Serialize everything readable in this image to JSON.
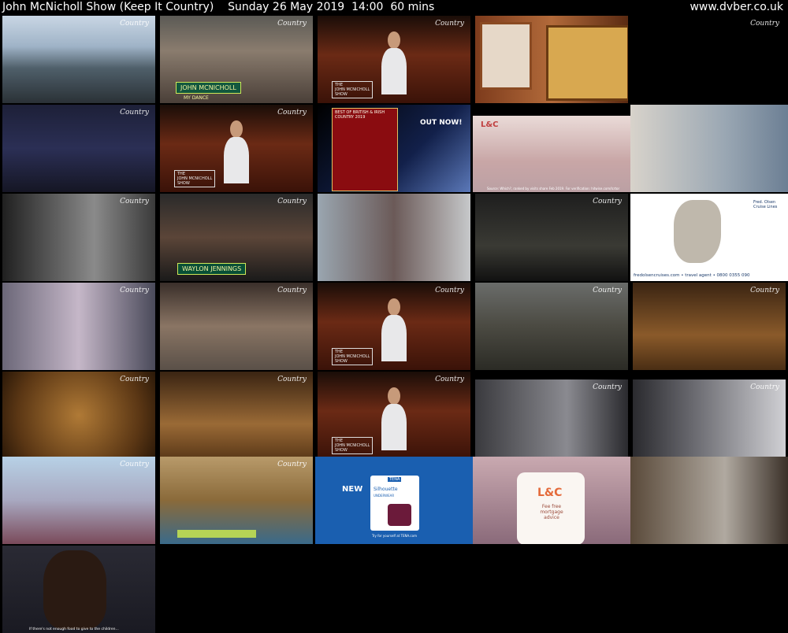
{
  "header": {
    "title": "John McNicholl Show (Keep It Country)    Sunday 26 May 2019  14:00  60 mins",
    "site": "www.dvber.co.uk"
  },
  "overlays": {
    "channel_logo": "Country",
    "caption_john": "JOHN MCNICHOLL",
    "caption_john_sub": "MY DANCE",
    "show_tag": "THE\nJOHN MCNICHOLL\nSHOW",
    "out_now": "OUT NOW!",
    "album_banner": "BEST OF BRITISH & IRISH COUNTRY 2019",
    "lc_disclaimer": "Source: Which?, ranked by visits share Feb 2019. For verification: hitwise.com/lcrtor",
    "caption_waylon": "WAYLON JENNINGS",
    "fred_url": "fredolsencruises.com • travel agent • 0800 0355 090",
    "fred_brand": "Fred. Olsen Cruise Lines",
    "tena_new": "NEW",
    "tena_brand": "TENA",
    "tena_product": "Silhouette",
    "tena_sub": "UNDERWEAR",
    "tena_footer": "Try for yourself at TENA.com",
    "lc_brand": "L&C",
    "lc_tagline": "Fee free mortgage advice",
    "charity_subtitle": "If there's not enough food to give to the children..."
  },
  "thumbnails": [
    {
      "name": "frame-bridge-walk",
      "bg": "linear-gradient(180deg,#c9d6e4 0%,#9fb3c7 35%,#4f5f6a 60%,#2a3136 100%)"
    },
    {
      "name": "frame-street-dancers",
      "bg": "linear-gradient(180deg,#5b5a55 0%,#8a7c6e 40%,#4a3f38 100%)"
    },
    {
      "name": "frame-studio-presenter",
      "bg": "linear-gradient(180deg,#1a0d08 0%,#6b2a15 45%,#3a1208 100%)"
    },
    {
      "name": "frame-photo-frames",
      "bg": "linear-gradient(90deg,#7d3b1c 0%,#b26a3a 50%,#5a2a12 100%)"
    },
    {
      "name": "frame-black",
      "bg": "#000"
    },
    {
      "name": "frame-recording-booth",
      "bg": "linear-gradient(180deg,#1d2038 0%,#2b2f55 50%,#151624 100%)"
    },
    {
      "name": "frame-studio-presenter-2",
      "bg": "linear-gradient(180deg,#1a0d08 0%,#6b2a15 45%,#3a1208 100%)"
    },
    {
      "name": "frame-album-ad",
      "bg": "linear-gradient(135deg,#000 0%,#12204a 60%,#5b78b8 100%)"
    },
    {
      "name": "frame-lc-swan",
      "bg": "linear-gradient(180deg,#eadbd8 0%,#c8a6a6 60%,#bba0a4 100%)"
    },
    {
      "name": "frame-jeans",
      "bg": "linear-gradient(90deg,#d8d3cb 0%,#9aa7b3 60%,#6c7f94 100%)"
    },
    {
      "name": "frame-bw-singer",
      "bg": "linear-gradient(90deg,#202020 0%,#8a8a8a 60%,#3a3a3a 100%)"
    },
    {
      "name": "frame-waylon",
      "bg": "linear-gradient(180deg,#2a2a2a 0%,#5b4538 50%,#1a1a1a 100%)"
    },
    {
      "name": "frame-female-singer",
      "bg": "linear-gradient(90deg,#9aa6b0 0%,#6b5a58 50%,#c6c8ca 100%)"
    },
    {
      "name": "frame-fiddle-band",
      "bg": "linear-gradient(180deg,#1e1e1e 0%,#3a3a34 60%,#111 100%)"
    },
    {
      "name": "frame-cruise-map",
      "bg": "#ffffff"
    },
    {
      "name": "frame-flowers",
      "bg": "linear-gradient(90deg,#6b6778 0%,#c5b7c8 50%,#4a4a5a 100%)"
    },
    {
      "name": "frame-market",
      "bg": "linear-gradient(180deg,#3a2f2a 0%,#8a7564 50%,#5a5048 100%)"
    },
    {
      "name": "frame-studio-presenter-3",
      "bg": "linear-gradient(180deg,#1a0d08 0%,#6b2a15 45%,#3a1208 100%)"
    },
    {
      "name": "frame-forest",
      "bg": "linear-gradient(180deg,#6a6c6a 0%,#4b4a42 50%,#2b2b25 100%)"
    },
    {
      "name": "frame-stairs-sepia",
      "bg": "linear-gradient(180deg,#3a2412 0%,#8a5a2a 60%,#4a2e14 100%)"
    },
    {
      "name": "frame-sepia-blur",
      "bg": "radial-gradient(circle at 50% 50%,#b07a36 0%,#5a3614 70%,#2a1808 100%)"
    },
    {
      "name": "frame-stairs-sepia-2",
      "bg": "linear-gradient(180deg,#3a2412 0%,#9a6a36 60%,#5a3818 100%)"
    },
    {
      "name": "frame-studio-presenter-4",
      "bg": "linear-gradient(180deg,#1a0d08 0%,#6b2a15 45%,#3a1208 100%)"
    },
    {
      "name": "frame-mic-singer",
      "bg": "linear-gradient(90deg,#3a3a3e 0%,#8a8a90 60%,#2a2a2e 100%)"
    },
    {
      "name": "frame-mic-singer-2",
      "bg": "linear-gradient(90deg,#2a2a2e 0%,#6a6a70 40%,#d0d0d4 100%)"
    },
    {
      "name": "frame-funfair-chat",
      "bg": "linear-gradient(180deg,#b7d1e6 0%,#a8a8c0 50%,#7a4a5a 100%)"
    },
    {
      "name": "frame-carousel",
      "bg": "linear-gradient(180deg,#b89a6a 0%,#8a6a3a 50%,#3a6a8a 100%)"
    },
    {
      "name": "frame-tena-ad",
      "bg": "#1a5fb0"
    },
    {
      "name": "frame-lc-ad",
      "bg": "linear-gradient(180deg,#c9a9b0 0%,#8a6a7a 100%)"
    },
    {
      "name": "frame-children",
      "bg": "linear-gradient(90deg,#5a4a3a 0%,#b0a9a0 60%,#3a3028 100%)"
    },
    {
      "name": "frame-charity-woman",
      "bg": "linear-gradient(180deg,#2a2a34 0%,#1a1a22 100%)"
    }
  ]
}
